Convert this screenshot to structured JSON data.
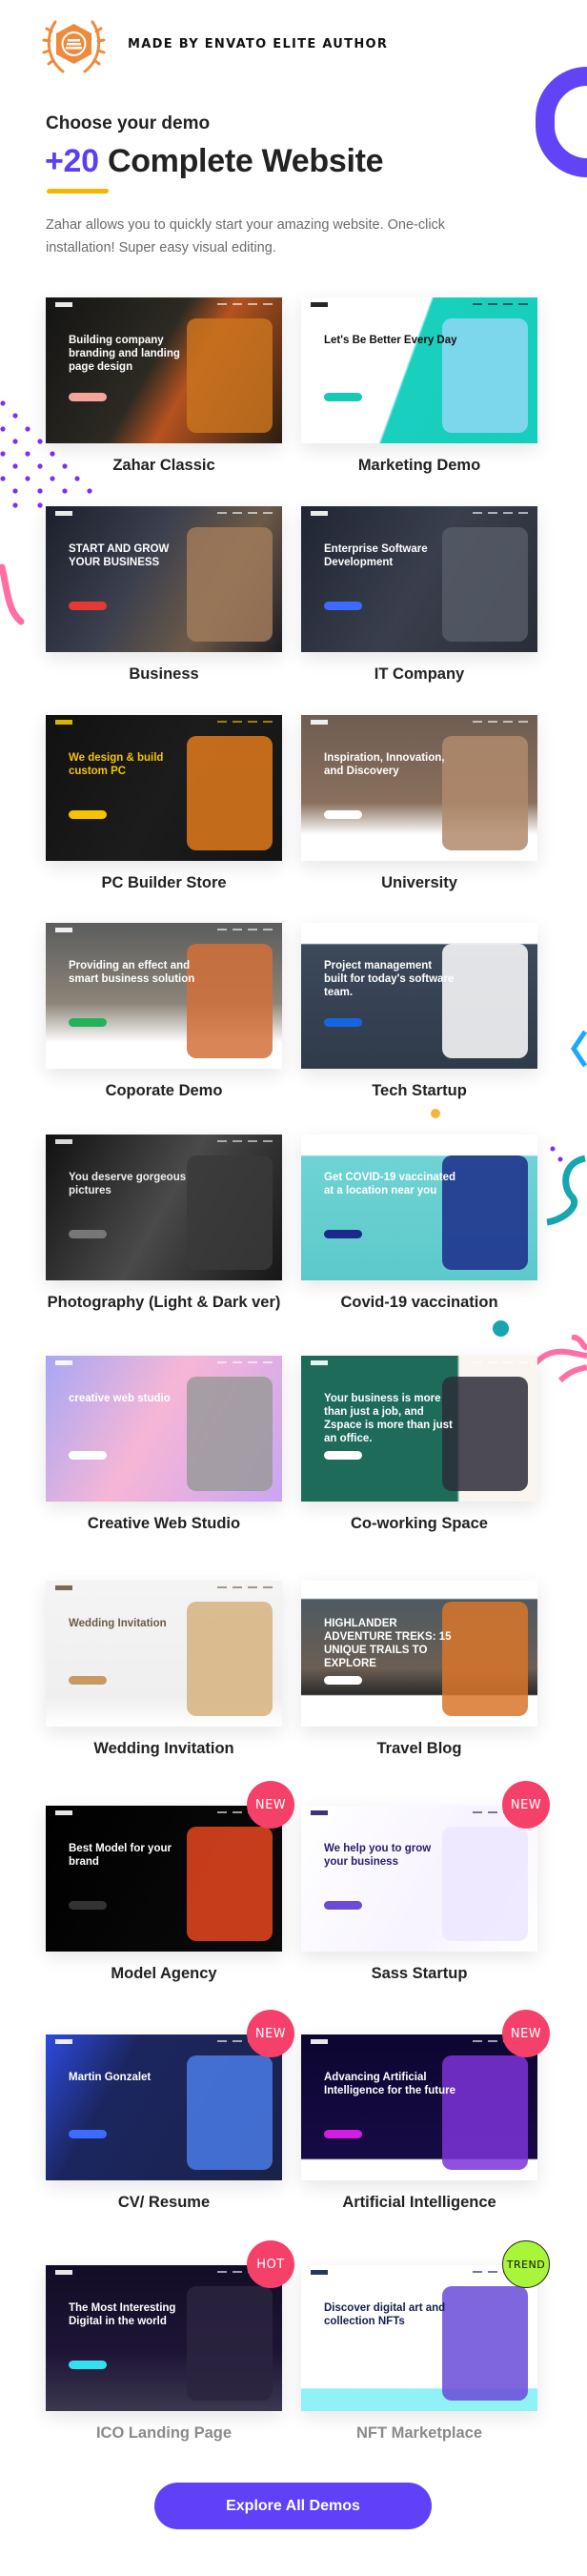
{
  "header": {
    "badge_text": "MADE BY ENVATO ELITE AUTHOR",
    "subtitle": "Choose your demo",
    "title_count": "+20",
    "title_text": "Complete Website",
    "intro": "Zahar allows you to quickly start your amazing website. One-click installation! Super easy visual editing."
  },
  "colors": {
    "accent": "#6040f8",
    "ring": "#6244f6",
    "underline": "#f7b500",
    "tag_red": "#f5406a",
    "tag_trend": "#a8f53a",
    "logo": "#ef8a3c"
  },
  "demos": [
    {
      "label": "Zahar Classic",
      "preview": "Building company branding and landing page design",
      "bg": "linear-gradient(120deg,#141414 0%,#2c2a22 45%,#b5521f 60%,#2a1e12 100%)",
      "fg": "#fff",
      "btn": "#f3a59c",
      "art": "#c9731f"
    },
    {
      "label": "Marketing Demo",
      "preview": "Let's Be Better Every Day",
      "bg": "linear-gradient(110deg,#ffffff 0%,#ffffff 45%,#18d0bd 46%,#17cdbc 100%)",
      "fg": "#111",
      "btn": "#17c9b5",
      "art": "#8fd8f5"
    },
    {
      "label": "Business",
      "preview": "START AND GROW YOUR BUSINESS",
      "bg": "linear-gradient(120deg,#1c1f2b 0%,#3b3f4e 40%,#6b5a48 70%,#1d1d25 100%)",
      "fg": "#fff",
      "btn": "#e53935",
      "art": "#a07a5a"
    },
    {
      "label": "IT Company",
      "preview": "Enterprise Software Development",
      "bg": "linear-gradient(120deg,#202533 0%,#3a3f4d 50%,#2a2d38 100%)",
      "fg": "#fff",
      "btn": "#3d6bff",
      "art": "#555a66"
    },
    {
      "label": "PC Builder Store",
      "preview": "We design & build custom PC",
      "bg": "linear-gradient(120deg,#111 0%,#1c1c1c 50%,#141414 100%)",
      "fg": "#f5c400",
      "btn": "#f5c400",
      "art": "#e07a1b"
    },
    {
      "label": "University",
      "preview": "Inspiration, Innovation, and Discovery",
      "bg": "linear-gradient(180deg,#6e5d52 0%,#8a6f5c 60%,#ffffff 82%,#ffffff 100%)",
      "fg": "#fff",
      "btn": "#ffffff",
      "art": "#b08a6c"
    },
    {
      "label": "Coporate Demo",
      "preview": "Providing an effect and smart business solution",
      "bg": "linear-gradient(180deg,#5b5d5e 0%,#8c8478 55%,#ffffff 82%,#ffffff 100%)",
      "fg": "#fff",
      "btn": "#22b35a",
      "art": "#d2703a"
    },
    {
      "label": "Tech Startup",
      "preview": "Project management built for today's software team.",
      "bg": "linear-gradient(180deg,#ffffff 0%,#ffffff 14%,#3d4a5c 15%,#2f3a4a 100%)",
      "fg": "#fff",
      "btn": "#1565e0",
      "art": "#ffffff"
    },
    {
      "label": "Photography (Light & Dark ver)",
      "preview": "You deserve gorgeous pictures",
      "bg": "linear-gradient(120deg,#111 0%,#4a4a4a 50%,#161616 100%)",
      "fg": "#eee",
      "btn": "#777",
      "art": "#3a3a3a"
    },
    {
      "label": "Covid-19 vaccination",
      "preview": "Get COVID-19 vaccinated at a location near you",
      "bg": "linear-gradient(180deg,#ffffff 0%,#ffffff 14%,#6fd3d3 15%,#5cc9cb 100%)",
      "fg": "#fff",
      "btn": "#1b2a8a",
      "art": "#1b2a8a"
    },
    {
      "label": "Creative Web Studio",
      "preview": "creative web studio",
      "bg": "linear-gradient(120deg,#a7a7f5 0%,#f6b6d6 45%,#c9a6f2 100%)",
      "fg": "#fff",
      "btn": "#ffffff",
      "art": "#9a9a9a"
    },
    {
      "label": "Co-working Space",
      "preview": "Your business is more than just a job, and Zspace is more than just an office.",
      "bg": "linear-gradient(90deg,#1e6b5a 0%,#1e6b5a 66%,#fbf5ef 67%,#fbf5ef 100%)",
      "fg": "#fff",
      "btn": "#ffffff",
      "art": "#2d2d3a"
    },
    {
      "label": "Wedding Invitation",
      "preview": "Wedding Invitation",
      "bg": "linear-gradient(180deg,#f4f4f4 0%,#efefef 80%,#ffffff 100%)",
      "fg": "#6b5a44",
      "btn": "#c89a62",
      "art": "#d6b27e"
    },
    {
      "label": "Travel Blog",
      "preview": "HIGHLANDER ADVENTURE TREKS: 15 UNIQUE TRAILS TO EXPLORE",
      "bg": "linear-gradient(180deg,#ffffff 0%,#ffffff 12%,#4e5a62 13%,#6b5e54 60%,#2b2b2b 78%,#ffffff 79%)",
      "fg": "#fff",
      "btn": "#ffffff",
      "art": "#d9762a"
    },
    {
      "label": "Model Agency",
      "preview": "Best Model for your brand",
      "bg": "linear-gradient(120deg,#000 0%,#0b0b0b 100%)",
      "fg": "#fff",
      "btn": "#333",
      "art": "#e8461e",
      "tag": "NEW"
    },
    {
      "label": "Sass Startup",
      "preview": "We help you to grow your business",
      "bg": "linear-gradient(120deg,#ffffff 0%,#f7f3ff 60%,#ffffff 100%)",
      "fg": "#2a1b6e",
      "btn": "#6c4bd8",
      "art": "#ece6ff",
      "tag": "NEW"
    },
    {
      "label": "CV/ Resume",
      "preview": "Martin Gonzalet",
      "bg": "linear-gradient(120deg,#2d4be0 0%,#1b2660 30%,#1b2248 100%)",
      "fg": "#fff",
      "btn": "#3b6cff",
      "art": "#4a7be8",
      "tag": "NEW"
    },
    {
      "label": "Artificial Intelligence",
      "preview": "Advancing Artificial Intelligence for the future",
      "bg": "linear-gradient(180deg,#0c0630 0%,#170a45 85%,#ffffff 86%)",
      "fg": "#fff",
      "btn": "#d21ee0",
      "art": "#7d32d8",
      "tag": "NEW"
    },
    {
      "label": "ICO Landing Page",
      "preview": "The Most Interesting Digital in the world",
      "bg": "linear-gradient(180deg,#120d26 0%,#1e1536 60%,#3b3850 100%)",
      "fg": "#fff",
      "btn": "#33e0f0",
      "art": "#2b2540",
      "tag": "HOT",
      "fade": true
    },
    {
      "label": "NFT Marketplace",
      "preview": "Discover digital art and collection NFTs",
      "bg": "linear-gradient(180deg,#ffffff 0%,#ffffff 84%,#8ff2f5 85%,#8ff2f5 100%)",
      "fg": "#14204a",
      "btn": "#ffffff",
      "art": "#6a4bd8",
      "tag": "TREND",
      "fade": true
    }
  ],
  "explore_button": "Explore All Demos"
}
